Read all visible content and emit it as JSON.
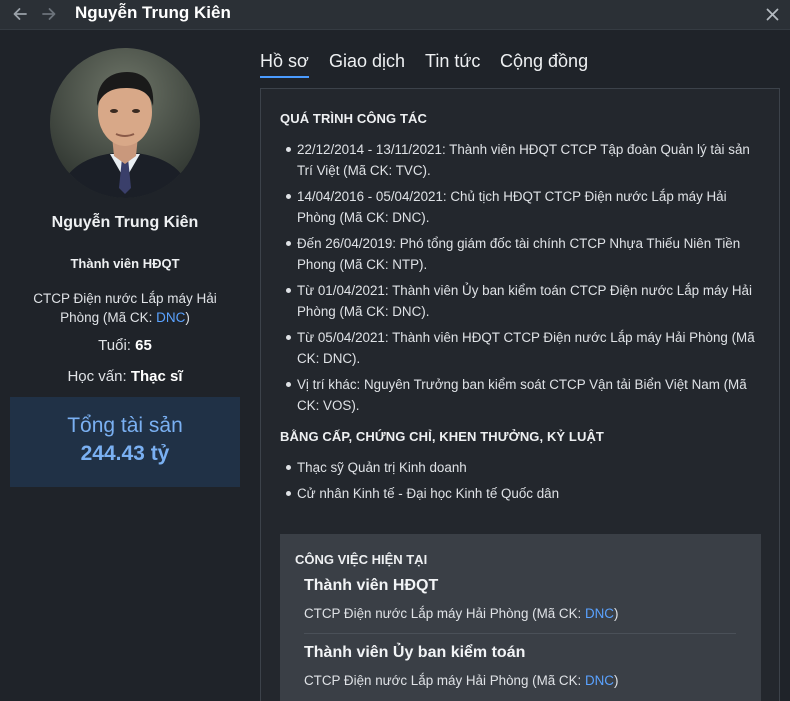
{
  "window": {
    "title": "Nguyễn Trung Kiên"
  },
  "icons": {
    "back": "arrow-left-icon",
    "forward": "arrow-right-icon",
    "close": "close-icon"
  },
  "colors": {
    "accent": "#4a9bff",
    "link": "#5aa2ff",
    "assets_bg": "#203146",
    "assets_text": "#7ab0f2"
  },
  "profile": {
    "name": "Nguyễn Trung Kiên",
    "role": "Thành viên HĐQT",
    "company_prefix": "CTCP Điện nước Lắp máy Hải Phòng (Mã CK: ",
    "company_code": "DNC",
    "company_suffix": ")",
    "age_label": "Tuổi:",
    "age_value": "65",
    "education_label": "Học vấn:",
    "education_value": "Thạc sĩ",
    "assets_label": "Tổng tài sản",
    "assets_value": "244.43 tỷ"
  },
  "tabs": [
    {
      "label": "Hồ sơ",
      "active": true
    },
    {
      "label": "Giao dịch",
      "active": false
    },
    {
      "label": "Tin tức",
      "active": false
    },
    {
      "label": "Cộng đồng",
      "active": false
    }
  ],
  "career": {
    "title": "QUÁ TRÌNH CÔNG TÁC",
    "items": [
      "22/12/2014 - 13/11/2021: Thành viên HĐQT CTCP Tập đoàn Quản lý tài sản Trí Việt (Mã CK: TVC).",
      "14/04/2016 - 05/04/2021: Chủ tịch HĐQT CTCP Điện nước Lắp máy Hải Phòng (Mã CK: DNC).",
      "Đến 26/04/2019: Phó tổng giám đốc tài chính CTCP Nhựa Thiếu Niên Tiền Phong (Mã CK: NTP).",
      "Từ 01/04/2021: Thành viên Ủy ban kiểm toán CTCP Điện nước Lắp máy Hải Phòng (Mã CK: DNC).",
      "Từ 05/04/2021: Thành viên HĐQT CTCP Điện nước Lắp máy Hải Phòng (Mã CK: DNC).",
      "Vị trí khác: Nguyên Trưởng ban kiểm soát CTCP Vận tải Biển Việt Nam (Mã CK: VOS)."
    ]
  },
  "degrees": {
    "title": "BẰNG CẤP, CHỨNG CHỈ, KHEN THƯỞNG, KỶ LUẬT",
    "items": [
      "Thạc sỹ Quản trị Kinh doanh",
      "Cử nhân Kinh tế - Đại học Kinh tế Quốc dân"
    ]
  },
  "current_jobs": {
    "title": "CÔNG VIỆC HIỆN TẠI",
    "jobs": [
      {
        "title": "Thành viên HĐQT",
        "company_prefix": "CTCP Điện nước Lắp máy Hải Phòng (Mã CK: ",
        "code": "DNC",
        "company_suffix": ")"
      },
      {
        "title": "Thành viên Ủy ban kiểm toán",
        "company_prefix": "CTCP Điện nước Lắp máy Hải Phòng (Mã CK: ",
        "code": "DNC",
        "company_suffix": ")"
      }
    ]
  }
}
